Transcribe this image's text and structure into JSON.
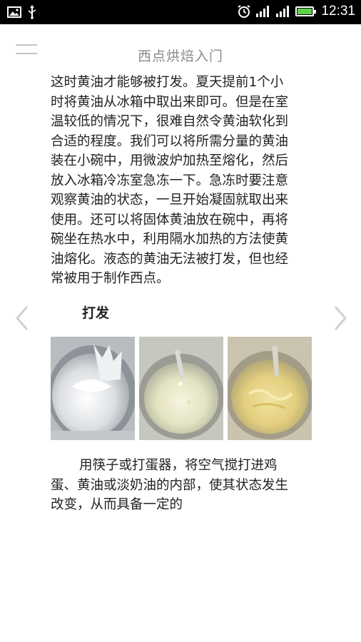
{
  "status_bar": {
    "time": "12:31",
    "left_icons": [
      "image-icon",
      "usb-icon"
    ],
    "right_icons": [
      "alarm-icon",
      "signal-icon",
      "signal-icon",
      "battery-icon"
    ],
    "battery_color": "#5fd34a"
  },
  "header": {
    "title": "西点烘焙入门",
    "menu_icon": "menu-icon"
  },
  "article": {
    "paragraph_1": "这时黄油才能够被打发。夏天提前1个小时将黄油从冰箱中取出来即可。但是在室温较低的情况下，很难自然令黄油软化到合适的程度。我们可以将所需分量的黄油装在小碗中，用微波炉加热至熔化，然后放入冰箱冷冻室急冻一下。急冻时要注意观察黄油的状态，一旦开始凝固就取出来使用。还可以将固体黄油放在碗中，再将碗坐在热水中，利用隔水加热的方法使黄油熔化。液态的黄油无法被打发，但也经常被用于制作西点。",
    "section_heading": "打发",
    "photos": [
      "whipped-cream-photo",
      "flour-butter-photo",
      "creamed-butter-photo"
    ],
    "paragraph_2": "用筷子或打蛋器，将空气搅打进鸡蛋、黄油或淡奶油的内部，使其状态发生改变，从而具备一定的"
  },
  "navigation": {
    "prev_icon": "chevron-left-icon",
    "next_icon": "chevron-right-icon",
    "arrow_color": "#d0d0d0"
  }
}
